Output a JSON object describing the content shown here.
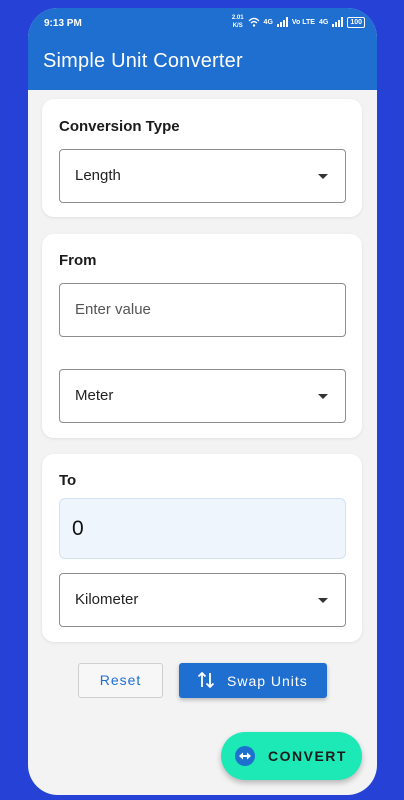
{
  "status_bar": {
    "time": "9:13 PM",
    "net_speed_value": "2.01",
    "net_speed_unit": "K/S",
    "network_1": "4G",
    "network_2": "Vo LTE",
    "network_3": "4G",
    "battery": "100"
  },
  "app_bar": {
    "title": "Simple Unit Converter"
  },
  "conversion_type": {
    "label": "Conversion Type",
    "selected": "Length"
  },
  "from": {
    "label": "From",
    "value_placeholder": "Enter value",
    "unit_selected": "Meter"
  },
  "to": {
    "label": "To",
    "result": "0",
    "unit_selected": "Kilometer"
  },
  "actions": {
    "reset_label": "Reset",
    "swap_label": "Swap Units",
    "convert_label": "CONVERT"
  },
  "colors": {
    "primary": "#1f6fd0",
    "accent": "#1de9b6",
    "background": "#2541d6"
  }
}
